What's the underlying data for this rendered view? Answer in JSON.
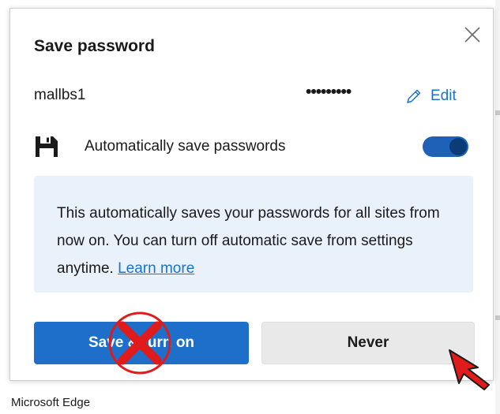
{
  "dialog": {
    "title": "Save password",
    "account": {
      "username": "mallbs1",
      "password_mask": "•••••••••",
      "edit_label": "Edit"
    },
    "auto_save": {
      "label": "Automatically save passwords",
      "enabled": true
    },
    "info": {
      "text": "This automatically saves your passwords for all sites from now on. You can turn off automatic save from settings anytime.",
      "link_label": "Learn more"
    },
    "buttons": {
      "primary_label": "Save & turn on",
      "secondary_label": "Never"
    }
  },
  "footer": {
    "app_name": "Microsoft Edge"
  },
  "icons": {
    "close": "close-icon",
    "edit": "pencil-icon",
    "save": "floppy-disk-icon",
    "annotation": "red-x-circle-icon",
    "pointer": "red-cursor-arrow-icon"
  },
  "colors": {
    "accent": "#1e6fc9",
    "link": "#1a73c9",
    "toggle_on": "#1e62b8",
    "info_bg": "#e9f2fb",
    "annotation_red": "#e01b1b"
  }
}
